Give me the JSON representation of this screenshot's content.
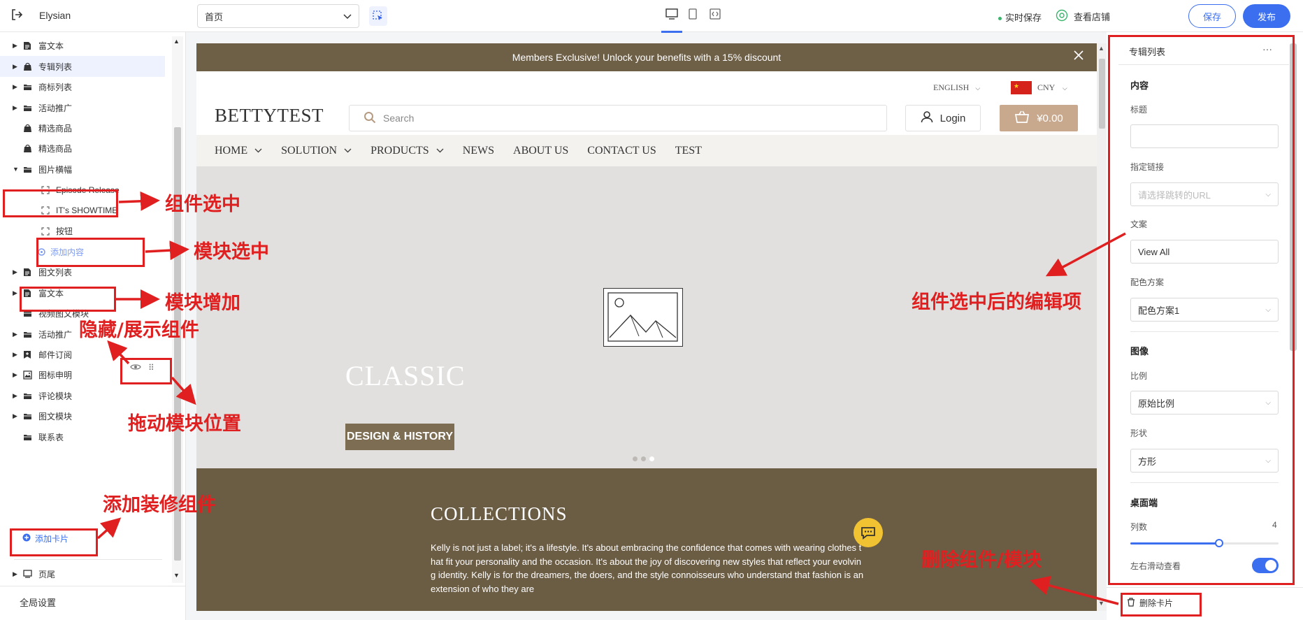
{
  "topbar": {
    "app_name": "Elysian",
    "page_select": "首页",
    "autosave": "实时保存",
    "view_store": "查看店铺",
    "save": "保存",
    "publish": "发布"
  },
  "sidebar": {
    "items": [
      {
        "label": "富文本",
        "icon": "document-icon",
        "caret": true
      },
      {
        "label": "专辑列表",
        "icon": "tag-icon",
        "caret": true,
        "active": true
      },
      {
        "label": "商标列表",
        "icon": "folder-icon",
        "caret": true
      },
      {
        "label": "活动推广",
        "icon": "folder-icon",
        "caret": true
      },
      {
        "label": "精选商品",
        "icon": "bag-icon",
        "caret": false
      },
      {
        "label": "精选商品",
        "icon": "bag-icon",
        "caret": false
      },
      {
        "label": "图片横幅",
        "icon": "folder-icon",
        "caret": true,
        "expanded": true
      },
      {
        "label": "Episode Release",
        "icon": "bracket-icon",
        "child": true
      },
      {
        "label": "IT's SHOWTIME",
        "icon": "bracket-icon",
        "child": true
      },
      {
        "label": "按钮",
        "icon": "bracket-icon",
        "child": true
      },
      {
        "label": "添加内容",
        "icon": "plus-circle-icon",
        "add": true
      },
      {
        "label": "图文列表",
        "icon": "document-icon",
        "caret": true
      },
      {
        "label": "富文本",
        "icon": "document-icon",
        "caret": true
      },
      {
        "label": "视频图文模块",
        "icon": "folder-icon",
        "caret": false
      },
      {
        "label": "活动推广",
        "icon": "folder-icon",
        "caret": true
      },
      {
        "label": "邮件订阅",
        "icon": "bookmark-icon",
        "caret": true
      },
      {
        "label": "图标申明",
        "icon": "image-icon",
        "caret": true
      },
      {
        "label": "评论模块",
        "icon": "folder-icon",
        "caret": true
      },
      {
        "label": "图文模块",
        "icon": "folder-icon",
        "caret": true
      },
      {
        "label": "联系表",
        "icon": "folder-icon",
        "caret": false
      }
    ],
    "add_card": "添加卡片",
    "footer_label": "页尾",
    "global_settings": "全局设置"
  },
  "preview": {
    "announcement": "Members Exclusive! Unlock your benefits with a 15% discount",
    "language": "ENGLISH",
    "currency": "CNY",
    "logo": "BETTYTEST",
    "search_placeholder": "Search",
    "login": "Login",
    "cart_total": "¥0.00",
    "nav": [
      {
        "label": "HOME",
        "chevron": true
      },
      {
        "label": "SOLUTION",
        "chevron": true
      },
      {
        "label": "PRODUCTS",
        "chevron": true
      },
      {
        "label": "NEWS",
        "chevron": false
      },
      {
        "label": "ABOUT US",
        "chevron": false
      },
      {
        "label": "CONTACT US",
        "chevron": false
      },
      {
        "label": "TEST",
        "chevron": false
      }
    ],
    "hero_title": "CLASSIC",
    "hero_button": "DESIGN & HISTORY",
    "collections_title": "COLLECTIONS",
    "collections_text": "Kelly is not just a label; it's a lifestyle. It's about embracing the confidence that comes with wearing clothes that fit your personality and the occasion. It's about the joy of discovering new styles that reflect your evolving identity. Kelly is for the dreamers, the doers, and the style connoisseurs who understand that fashion is an extension of who they are"
  },
  "panel": {
    "title": "专辑列表",
    "more": "···",
    "section_content": "内容",
    "label_title": "标题",
    "title_value": "",
    "label_link": "指定链接",
    "link_placeholder": "请选择跳转的URL",
    "label_copy": "文案",
    "copy_value": "View All",
    "label_scheme": "配色方案",
    "scheme_value": "配色方案1",
    "section_image": "图像",
    "label_ratio": "比例",
    "ratio_value": "原始比例",
    "label_shape": "形状",
    "shape_value": "方形",
    "section_desktop": "桌面端",
    "label_columns": "列数",
    "columns_value": "4",
    "label_swipe": "左右滑动查看",
    "swipe_on": true,
    "delete_card": "删除卡片"
  },
  "annotations": {
    "component_selected": "组件选中",
    "module_selected": "模块选中",
    "module_add": "模块增加",
    "toggle_visibility": "隐藏/展示组件",
    "drag_module": "拖动模块位置",
    "add_component": "添加装修组件",
    "edit_items": "组件选中后的编辑项",
    "delete_component": "删除组件/模块"
  },
  "colors": {
    "accent": "#3c6ef0",
    "annotation": "#e02020",
    "announce_bg": "#6e5f47",
    "collections_bg": "#6b5c44",
    "cart_bg": "#c9a98d"
  }
}
